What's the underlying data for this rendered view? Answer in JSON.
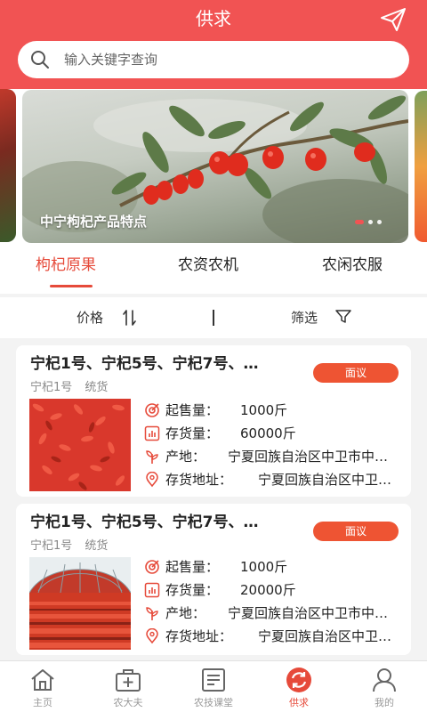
{
  "header": {
    "title": "供求",
    "search_placeholder": "输入关键字查询"
  },
  "banner": {
    "caption": "中宁枸杞产品特点",
    "dot_count": 3,
    "active_dot": 0
  },
  "tabs": [
    {
      "label": "枸杞原果",
      "active": true
    },
    {
      "label": "农资农机",
      "active": false
    },
    {
      "label": "农闲农服",
      "active": false
    }
  ],
  "sortbar": {
    "price_label": "价格",
    "filter_label": "筛选"
  },
  "listings": [
    {
      "title": "宁杞1号、宁杞5号、宁杞7号、…",
      "tags": [
        "宁杞1号",
        "统货"
      ],
      "price_badge": "面议",
      "min_qty_label": "起售量：",
      "min_qty": "1000斤",
      "stock_label": "存货量：",
      "stock": "60000斤",
      "origin_label": "产地：",
      "origin": "宁夏回族自治区中卫市中…",
      "address_label": "存货地址：",
      "address": "宁夏回族自治区中卫…"
    },
    {
      "title": "宁杞1号、宁杞5号、宁杞7号、…",
      "tags": [
        "宁杞1号",
        "统货"
      ],
      "price_badge": "面议",
      "min_qty_label": "起售量：",
      "min_qty": "1000斤",
      "stock_label": "存货量：",
      "stock": "20000斤",
      "origin_label": "产地：",
      "origin": "宁夏回族自治区中卫市中…",
      "address_label": "存货地址：",
      "address": "宁夏回族自治区中卫…"
    }
  ],
  "navbar": [
    {
      "label": "主页",
      "icon": "home-icon",
      "active": false
    },
    {
      "label": "农大夫",
      "icon": "medical-kit-icon",
      "active": false
    },
    {
      "label": "农技课堂",
      "icon": "document-icon",
      "active": false
    },
    {
      "label": "供求",
      "icon": "refresh-icon",
      "active": true
    },
    {
      "label": "我的",
      "icon": "user-icon",
      "active": false
    }
  ],
  "colors": {
    "brand_red": "#f15353",
    "active_tab": "#e64a3a",
    "badge": "#ee5433"
  }
}
